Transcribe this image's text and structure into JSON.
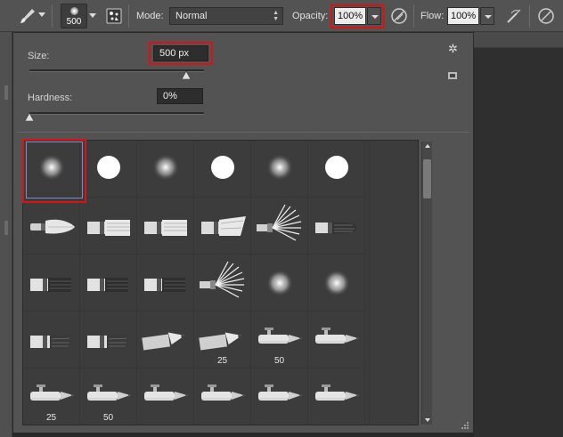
{
  "options_bar": {
    "brush_size_preview": "500",
    "mode_label": "Mode:",
    "mode_value": "Normal",
    "opacity_label": "Opacity:",
    "opacity_value": "100%",
    "flow_label": "Flow:",
    "flow_value": "100%"
  },
  "brush_panel": {
    "size_label": "Size:",
    "size_value": "500 px",
    "size_slider_fraction": 0.9,
    "hardness_label": "Hardness:",
    "hardness_value": "0%",
    "hardness_slider_fraction": 0.0
  },
  "presets": [
    {
      "kind": "soft-round",
      "label": "",
      "selected": true
    },
    {
      "kind": "hard-round",
      "label": ""
    },
    {
      "kind": "soft-round",
      "label": ""
    },
    {
      "kind": "hard-round",
      "label": ""
    },
    {
      "kind": "soft-round",
      "label": ""
    },
    {
      "kind": "hard-round",
      "label": ""
    },
    {
      "kind": "round-point-brush",
      "label": ""
    },
    {
      "kind": "flat-bristle-brush",
      "label": ""
    },
    {
      "kind": "flat-bristle-brush",
      "label": ""
    },
    {
      "kind": "angled-bristle-brush",
      "label": ""
    },
    {
      "kind": "fan-brush",
      "label": ""
    },
    {
      "kind": "round-bristle-brush",
      "label": ""
    },
    {
      "kind": "flat-blunt-brush",
      "label": ""
    },
    {
      "kind": "flat-blunt-brush",
      "label": ""
    },
    {
      "kind": "flat-blunt-brush",
      "label": ""
    },
    {
      "kind": "fan-brush",
      "label": ""
    },
    {
      "kind": "soft-round-small",
      "label": ""
    },
    {
      "kind": "soft-round-small",
      "label": ""
    },
    {
      "kind": "dark-bristle-brush",
      "label": ""
    },
    {
      "kind": "dark-bristle-brush",
      "label": ""
    },
    {
      "kind": "pencil",
      "label": ""
    },
    {
      "kind": "pencil",
      "label": "25"
    },
    {
      "kind": "airbrush-pen",
      "label": "50"
    },
    {
      "kind": "airbrush-pen",
      "label": ""
    },
    {
      "kind": "airbrush-pen",
      "label": "25"
    },
    {
      "kind": "airbrush-pen",
      "label": "50"
    },
    {
      "kind": "airbrush-pen",
      "label": ""
    },
    {
      "kind": "airbrush-pen",
      "label": ""
    },
    {
      "kind": "airbrush-pen",
      "label": ""
    },
    {
      "kind": "airbrush-pen",
      "label": ""
    }
  ]
}
